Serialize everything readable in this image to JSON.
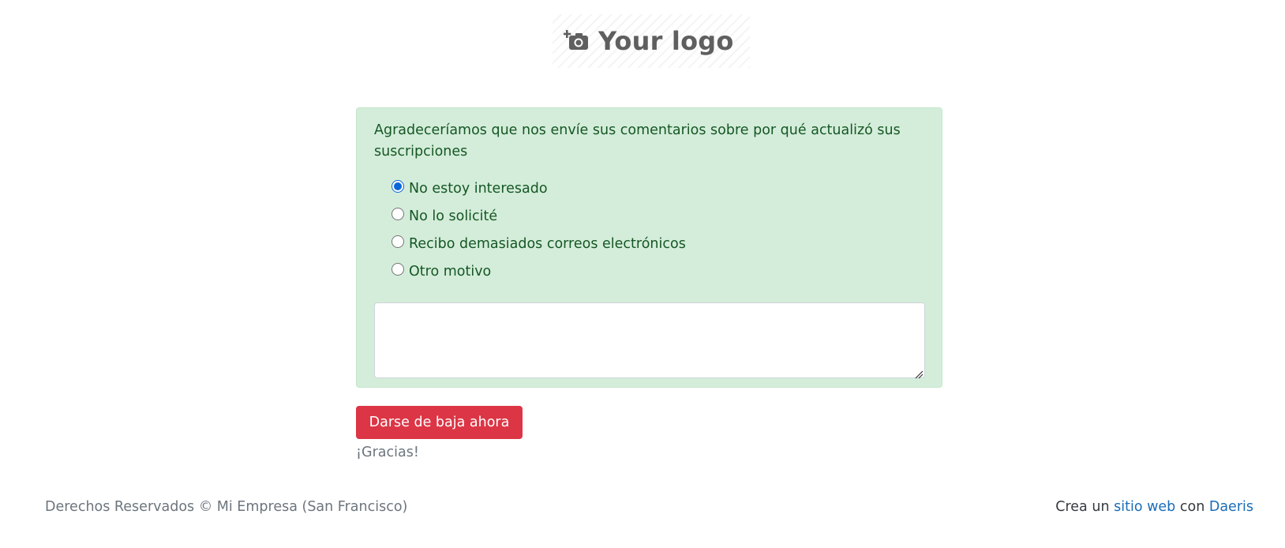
{
  "logo": {
    "text": "Your logo",
    "icon": "add-photo-camera-icon"
  },
  "survey": {
    "prompt": "Agradeceríamos que nos envíe sus comentarios sobre por qué actualizó sus suscripciones",
    "options": [
      {
        "label": "No estoy interesado",
        "checked": true
      },
      {
        "label": "No lo solicité",
        "checked": false
      },
      {
        "label": "Recibo demasiados correos electrónicos",
        "checked": false
      },
      {
        "label": "Otro motivo",
        "checked": false
      }
    ],
    "comment_value": ""
  },
  "actions": {
    "unsubscribe_label": "Darse de baja ahora",
    "thanks_text": "¡Gracias!"
  },
  "footer": {
    "copyright": "Derechos Reservados © Mi Empresa (San Francisco)",
    "credit_prefix": "Crea un",
    "credit_link_1": "sitio web",
    "credit_middle": "con",
    "credit_link_2": "Daeris"
  },
  "colors": {
    "alert_bg": "#d4edda",
    "alert_text": "#155724",
    "button_danger": "#dc3545",
    "radio_accent": "#0b67d8",
    "link": "#1a6db8"
  }
}
